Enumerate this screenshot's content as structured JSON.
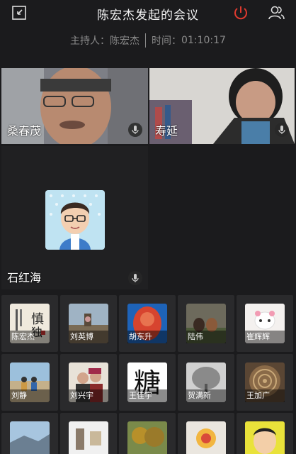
{
  "header": {
    "title": "陈宏杰发起的会议",
    "host_label": "主持人：",
    "host_name": "陈宏杰",
    "time_label": "时间：",
    "time_value": "01:10:17"
  },
  "main_videos": [
    {
      "name": "桑春茂"
    },
    {
      "name": "寿延"
    },
    {
      "name": "石红海"
    }
  ],
  "participants": [
    {
      "name": "陈宏杰",
      "icon": "calligraphy-avatar"
    },
    {
      "name": "刘英博",
      "icon": "landscape-avatar"
    },
    {
      "name": "胡东升",
      "icon": "red-figure-avatar"
    },
    {
      "name": "陆伟",
      "icon": "dogs-avatar"
    },
    {
      "name": "崔辉辉",
      "icon": "cartoon-avatar"
    },
    {
      "name": "刘静",
      "icon": "beach-avatar"
    },
    {
      "name": "刘兴宇",
      "icon": "couple-avatar"
    },
    {
      "name": "王佳宇",
      "icon": "calligraphy-tang-avatar",
      "glyph": "糖"
    },
    {
      "name": "贺满新",
      "icon": "tree-avatar"
    },
    {
      "name": "王加广",
      "icon": "mandala-avatar"
    },
    {
      "name": "",
      "icon": "sky-avatar"
    },
    {
      "name": "",
      "icon": "room-avatar"
    },
    {
      "name": "",
      "icon": "autumn-avatar"
    },
    {
      "name": "",
      "icon": "flower-avatar"
    },
    {
      "name": "",
      "icon": "cartoon-face-avatar"
    }
  ],
  "colors": {
    "power_icon": "#e03a2f",
    "background": "#1b1b1d"
  }
}
